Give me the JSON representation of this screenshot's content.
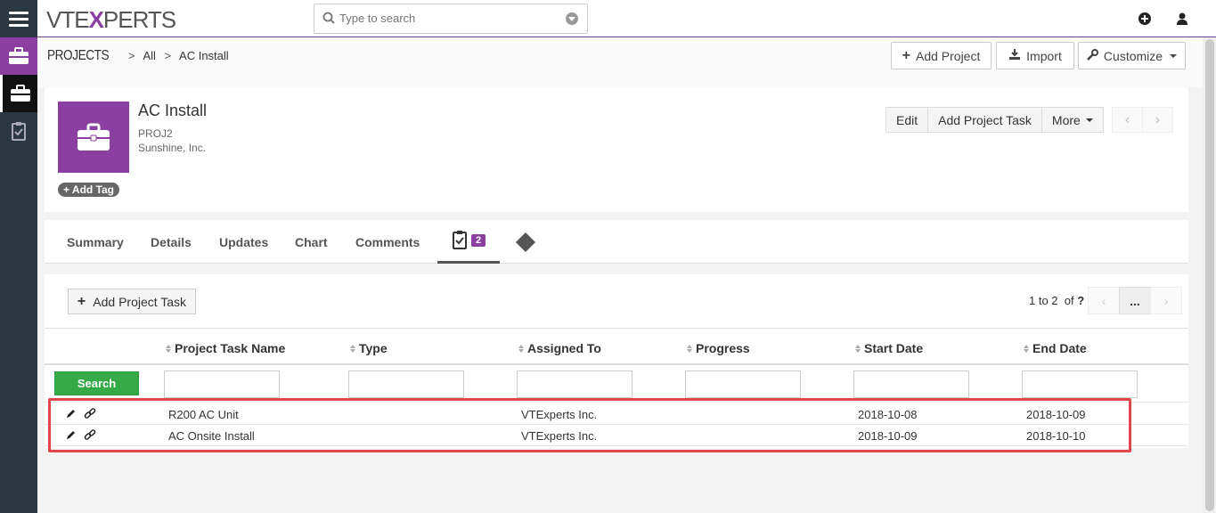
{
  "brand": {
    "prefix": "VTE",
    "x": "X",
    "suffix": "PERTS"
  },
  "search": {
    "placeholder": "Type to search"
  },
  "breadcrumb": {
    "module": "PROJECTS",
    "list": "All",
    "record": "AC Install"
  },
  "header_buttons": {
    "add_project": "Add Project",
    "import": "Import",
    "customize": "Customize"
  },
  "record": {
    "title": "AC Install",
    "code": "PROJ2",
    "organization": "Sunshine, Inc.",
    "add_tag": "Add Tag",
    "actions": {
      "edit": "Edit",
      "add_task": "Add Project Task",
      "more": "More"
    }
  },
  "tabs": [
    {
      "label": "Summary"
    },
    {
      "label": "Details"
    },
    {
      "label": "Updates"
    },
    {
      "label": "Chart"
    },
    {
      "label": "Comments"
    },
    {
      "label": "",
      "badge": "2"
    }
  ],
  "related": {
    "add_button": "Add Project Task",
    "pager": {
      "range": "1 to 2",
      "of": "of",
      "total": "?",
      "dots": "..."
    },
    "columns": [
      "Project Task Name",
      "Type",
      "Assigned To",
      "Progress",
      "Start Date",
      "End Date"
    ],
    "search_button": "Search",
    "rows": [
      {
        "name": "R200 AC Unit",
        "type": "",
        "assigned": "VTExperts Inc.",
        "progress": "",
        "start": "2018-10-08",
        "end": "2018-10-09"
      },
      {
        "name": "AC Onsite Install",
        "type": "",
        "assigned": "VTExperts Inc.",
        "progress": "",
        "start": "2018-10-09",
        "end": "2018-10-10"
      }
    ]
  },
  "colors": {
    "brand": "#8b3fa0",
    "rail": "#2b3842",
    "search_button": "#35aa47",
    "highlight": "#e0474c"
  }
}
